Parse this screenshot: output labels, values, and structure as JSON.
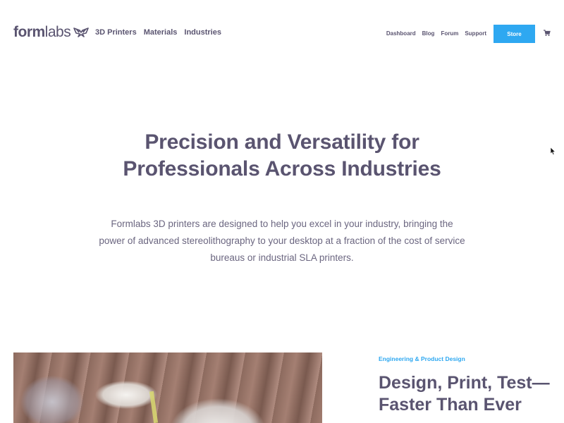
{
  "header": {
    "logo": {
      "bold": "form",
      "light": "labs",
      "icon": "butterfly-logo-icon"
    },
    "primary_nav": [
      {
        "label": "3D Printers"
      },
      {
        "label": "Materials"
      },
      {
        "label": "Industries"
      }
    ],
    "secondary_nav": [
      {
        "label": "Dashboard"
      },
      {
        "label": "Blog"
      },
      {
        "label": "Forum"
      },
      {
        "label": "Support"
      }
    ],
    "store_label": "Store",
    "cart_icon": "cart-icon"
  },
  "hero": {
    "title_line1": "Precision and Versatility for",
    "title_line2": "Professionals Across Industries",
    "text": "Formlabs 3D printers are designed to help you excel in your industry, bringing the power of advanced stereolithography to your desktop at a fraction of the cost of service bureaus or industrial SLA printers."
  },
  "feature": {
    "tag": "Engineering & Product Design",
    "title_line1": "Design, Print, Test—",
    "title_line2": "Faster Than Ever",
    "image_alt": "Light bulbs"
  },
  "colors": {
    "text": "#5a5470",
    "accent": "#2ea8f1"
  }
}
